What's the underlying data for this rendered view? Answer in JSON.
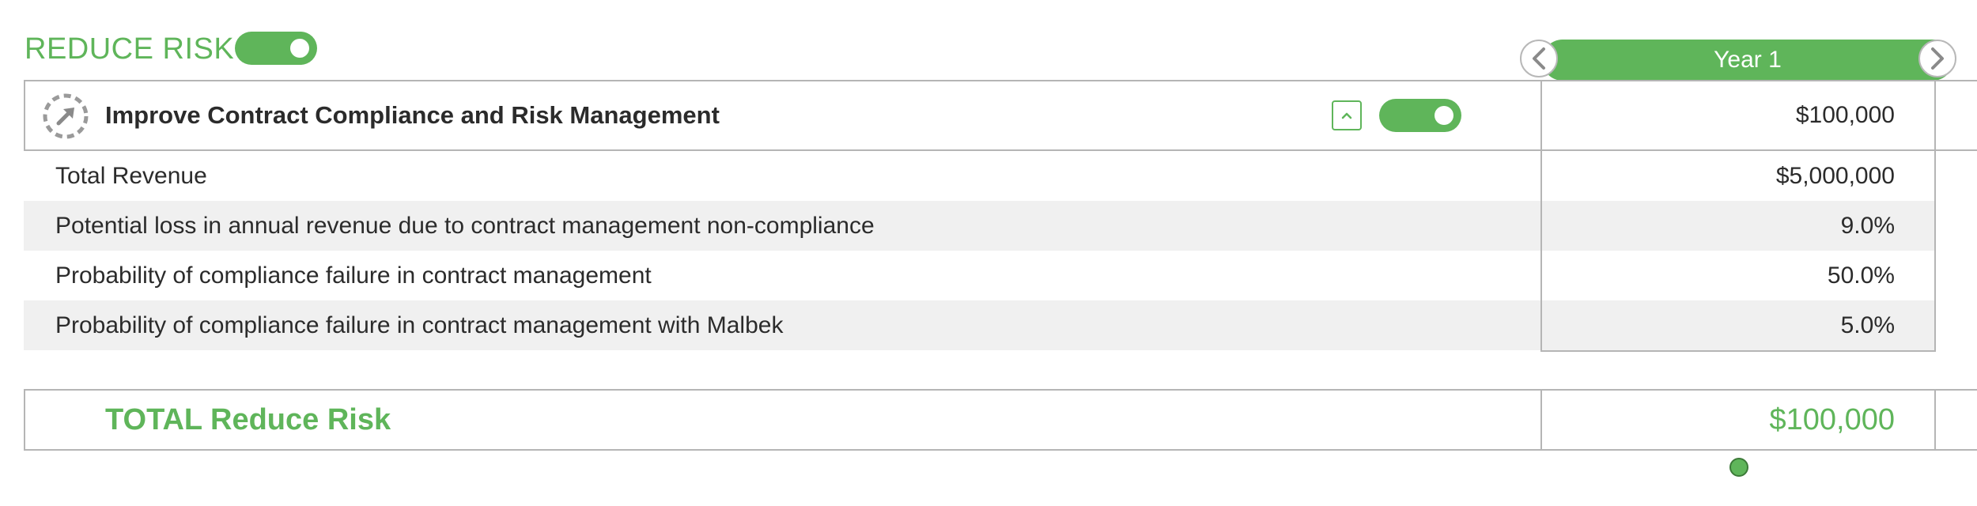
{
  "section": {
    "title": "REDUCE RISK",
    "toggle_on": true
  },
  "year_header": {
    "label": "Year 1",
    "prev_icon": "chevron-left-icon",
    "next_icon": "chevron-right-icon"
  },
  "group": {
    "title": "Improve Contract Compliance and Risk Management",
    "icon": "dashed-circle-arrow-icon",
    "collapse_icon": "chevron-up-icon",
    "toggle_on": true,
    "value": "$100,000"
  },
  "rows": [
    {
      "label": "Total Revenue",
      "value": "$5,000,000"
    },
    {
      "label": "Potential loss in annual revenue due to contract management non-compliance",
      "value": "9.0%"
    },
    {
      "label": "Probability of compliance failure in contract management",
      "value": "50.0%"
    },
    {
      "label": "Probability of compliance failure in contract management with Malbek",
      "value": "5.0%"
    }
  ],
  "total": {
    "label": "TOTAL Reduce Risk",
    "value": "$100,000"
  },
  "colors": {
    "accent": "#5fb55a",
    "border": "#b5b5b5",
    "row_alt": "#f0f0f0",
    "text": "#2b2b2b"
  }
}
